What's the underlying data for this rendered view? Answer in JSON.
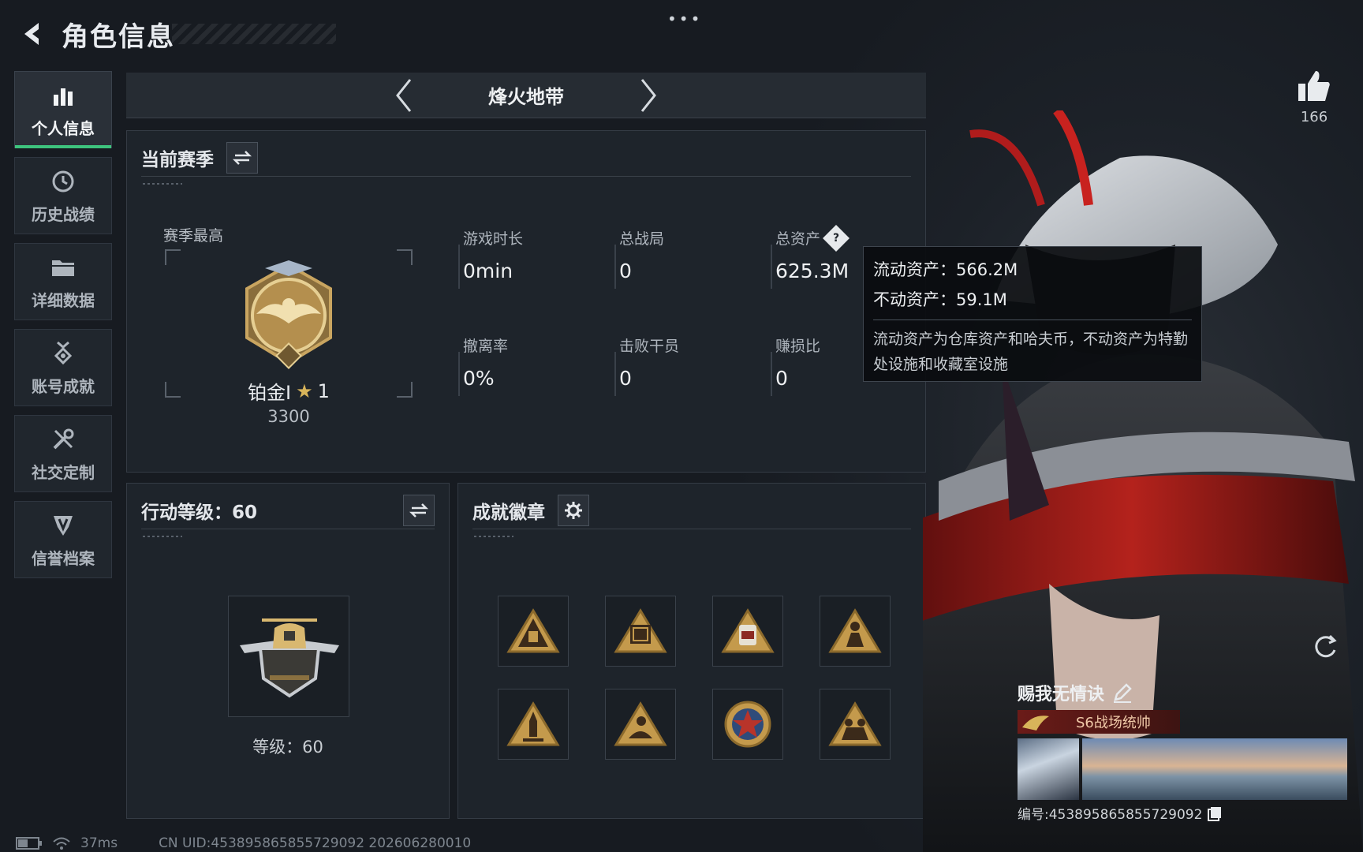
{
  "header": {
    "title": "角色信息",
    "menu_dots": "•••"
  },
  "sidebar": {
    "items": [
      {
        "label": "个人信息",
        "icon": "bar-chart-icon",
        "active": true
      },
      {
        "label": "历史战绩",
        "icon": "clock-history-icon",
        "active": false
      },
      {
        "label": "详细数据",
        "icon": "folder-icon",
        "active": false
      },
      {
        "label": "账号成就",
        "icon": "medal-icon",
        "active": false
      },
      {
        "label": "社交定制",
        "icon": "tools-icon",
        "active": false
      },
      {
        "label": "信誉档案",
        "icon": "shield-badge-icon",
        "active": false
      }
    ]
  },
  "mode_bar": {
    "title": "烽火地带"
  },
  "season": {
    "title": "当前赛季",
    "best_label": "赛季最高",
    "rank_name": "铂金I",
    "rank_star": "★",
    "rank_stars": "1",
    "rank_points": "3300",
    "stats": [
      {
        "label": "游戏时长",
        "value": "0min"
      },
      {
        "label": "总战局",
        "value": "0"
      },
      {
        "label": "总资产",
        "value": "625.3M"
      },
      {
        "label": "撤离率",
        "value": "0%"
      },
      {
        "label": "击败干员",
        "value": "0"
      },
      {
        "label": "赚损比",
        "value": "0"
      }
    ]
  },
  "tooltip": {
    "liquid": "流动资产：566.2M",
    "fixed": "不动资产：59.1M",
    "note": "流动资产为仓库资产和哈夫币，不动资产为特勤处设施和收藏室设施"
  },
  "level": {
    "title": "行动等级：60",
    "level_text": "等级：60"
  },
  "medals": {
    "title": "成就徽章",
    "items": [
      "rocket-triangle-icon",
      "crate-triangle-icon",
      "s8-triangle-icon",
      "soldier-triangle-icon",
      "missile-triangle-icon",
      "diver-triangle-icon",
      "star-round-medal-icon",
      "squad-triangle-icon"
    ]
  },
  "like": {
    "count": "166"
  },
  "profile": {
    "nickname": "赐我无情诀",
    "title_plate": "S6战场统帅",
    "uid": "编号:453895865855729092"
  },
  "status_bar": {
    "ping": "37ms",
    "uid_line": "CN UID:453895865855729092 202606280010"
  },
  "colors": {
    "accent_green": "#3ec47e",
    "gold": "#d8b45a",
    "background": "#1a1f26"
  }
}
